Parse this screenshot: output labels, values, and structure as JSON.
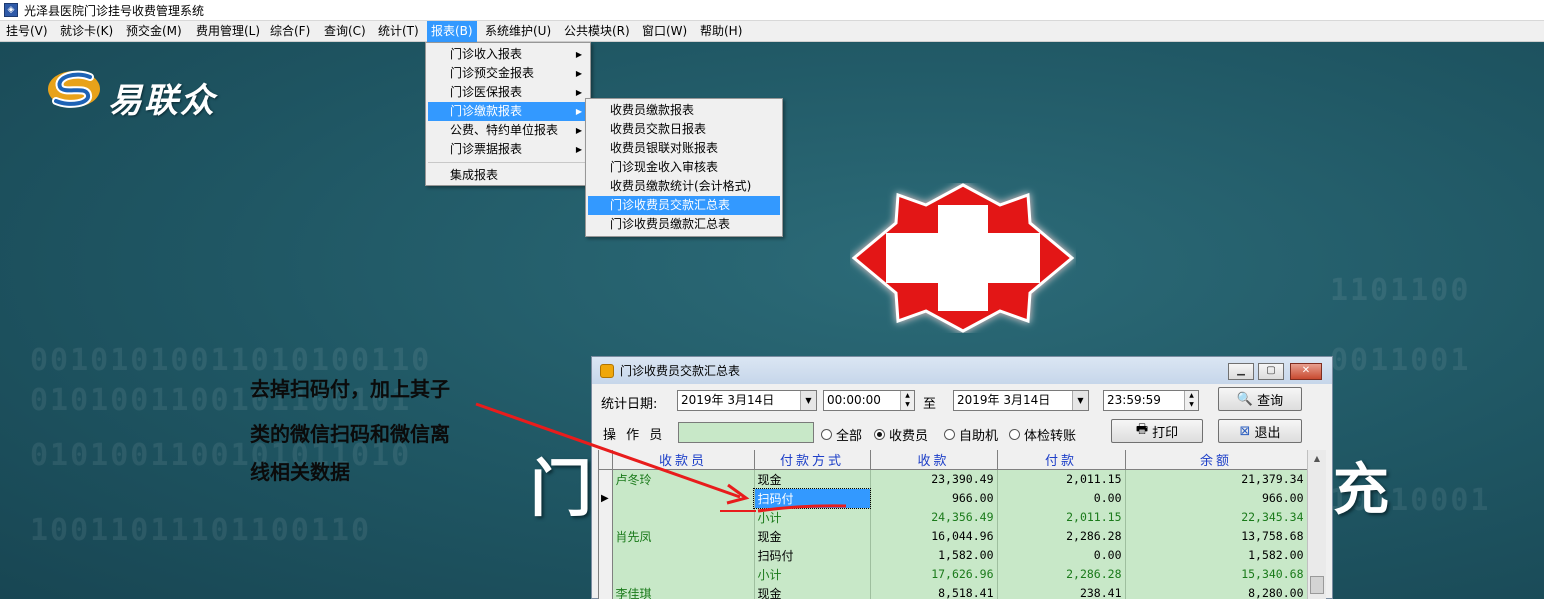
{
  "window": {
    "title": "光泽县医院门诊挂号收费管理系统"
  },
  "menubar": [
    {
      "label": "挂号(V)"
    },
    {
      "label": "就诊卡(K)"
    },
    {
      "label": "预交金(M)"
    },
    {
      "label": "费用管理(L)"
    },
    {
      "label": "综合(F)"
    },
    {
      "label": "查询(C)"
    },
    {
      "label": "统计(T)"
    },
    {
      "label": "报表(B)"
    },
    {
      "label": "系统维护(U)"
    },
    {
      "label": "公共模块(R)"
    },
    {
      "label": "窗口(W)"
    },
    {
      "label": "帮助(H)"
    }
  ],
  "report_menu": [
    {
      "label": "门诊收入报表"
    },
    {
      "label": "门诊预交金报表"
    },
    {
      "label": "门诊医保报表"
    },
    {
      "label": "门诊缴款报表"
    },
    {
      "label": "公费、特约单位报表"
    },
    {
      "label": "门诊票据报表"
    },
    {
      "label": "集成报表"
    }
  ],
  "payment_submenu": [
    {
      "label": "收费员缴款报表"
    },
    {
      "label": "收费员交款日报表"
    },
    {
      "label": "收费员银联对账报表"
    },
    {
      "label": "门诊现金收入审核表"
    },
    {
      "label": "收费员缴款统计(会计格式)"
    },
    {
      "label": "门诊收费员交款汇总表"
    },
    {
      "label": "门诊收费员缴款汇总表"
    }
  ],
  "background": {
    "brand_name": "易联众",
    "title_left": "门",
    "title_right": "充"
  },
  "annotation": {
    "lines": [
      "去掉扫码付，加上其子",
      "类的微信扫码和微信离",
      "线相关数据"
    ]
  },
  "dialog": {
    "title": "门诊收费员交款汇总表",
    "date_label": "统计日期:",
    "date_from": "2019年  3月14日",
    "time_from": "00:00:00",
    "to_label": "至",
    "date_to": "2019年  3月14日",
    "time_to": "23:59:59",
    "query_button": "查询",
    "operator_label": "操 作 员",
    "operator_value": "",
    "radios": [
      {
        "label": "全部",
        "checked": false
      },
      {
        "label": "收费员",
        "checked": true
      },
      {
        "label": "自助机",
        "checked": false
      },
      {
        "label": "体检转账",
        "checked": false
      }
    ],
    "print_button": "打印",
    "exit_button": "退出",
    "columns": [
      "收款员",
      "付款方式",
      "收款",
      "付款",
      "余额"
    ],
    "rows": [
      {
        "cashier": "卢冬玲",
        "method": "现金",
        "received": "23,390.49",
        "paid": "2,011.15",
        "balance": "21,379.34"
      },
      {
        "cashier": "",
        "method": "扫码付",
        "received": "966.00",
        "paid": "0.00",
        "balance": "966.00"
      },
      {
        "cashier": "",
        "method": "小计",
        "received": "24,356.49",
        "paid": "2,011.15",
        "balance": "22,345.34"
      },
      {
        "cashier": "肖先凤",
        "method": "现金",
        "received": "16,044.96",
        "paid": "2,286.28",
        "balance": "13,758.68"
      },
      {
        "cashier": "",
        "method": "扫码付",
        "received": "1,582.00",
        "paid": "0.00",
        "balance": "1,582.00"
      },
      {
        "cashier": "",
        "method": "小计",
        "received": "17,626.96",
        "paid": "2,286.28",
        "balance": "15,340.68"
      },
      {
        "cashier": "李佳琪",
        "method": "现金",
        "received": "8,518.41",
        "paid": "238.41",
        "balance": "8,280.00"
      }
    ]
  },
  "colors": {
    "background": "#1f5663",
    "menu_highlight": "#3399ff",
    "grid_bg": "#c8e8c8",
    "annotation_arrow": "#e81c1c"
  }
}
